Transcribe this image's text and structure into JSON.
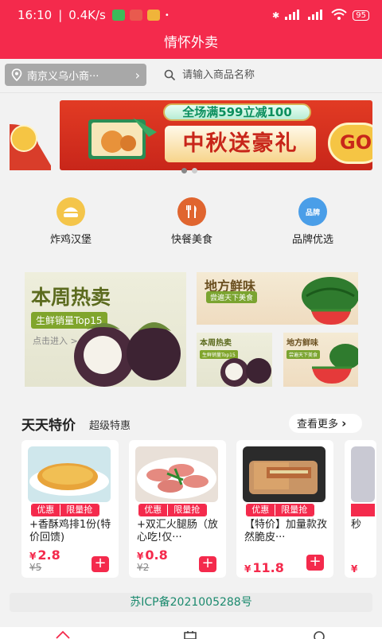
{
  "status_bar": {
    "time": "16:10",
    "speed": "0.4K/s",
    "battery": "95",
    "signal_label": "HD"
  },
  "header": {
    "title": "情怀外卖"
  },
  "location": {
    "label": "南京义乌小商···"
  },
  "search": {
    "placeholder": "请输入商品名称"
  },
  "banner": {
    "top_text": "全场满599立减100",
    "title": "中秋送豪礼",
    "go_label": "GO"
  },
  "categories": [
    {
      "label": "炸鸡汉堡",
      "icon": "burger-icon",
      "color": "#f4c54a"
    },
    {
      "label": "快餐美食",
      "icon": "fork-knife-icon",
      "color": "#e0652f"
    },
    {
      "label": "品牌优选",
      "icon": "brand-icon",
      "color": "#4a9ee8",
      "icon_text": "品牌"
    }
  ],
  "promos": {
    "big": {
      "title": "本周热卖",
      "tag": "生鲜销量Top15",
      "link": "点击进入 >"
    },
    "right_top": {
      "title": "地方鲜味",
      "tag": "尝遍天下美食"
    },
    "small_1": {
      "title": "本周热卖",
      "tag": "生鲜销量Top15"
    },
    "small_2": {
      "title": "地方鲜味",
      "tag": "尝遍天下美食"
    }
  },
  "deals": {
    "title": "天天特价",
    "subtitle": "超级特惠",
    "more_label": "查看更多",
    "tag_a": "优惠",
    "tag_b": "限量抢",
    "currency": "¥",
    "items": [
      {
        "name": "+香酥鸡排1份(特价回馈)",
        "price": "2.8",
        "orig": "¥5"
      },
      {
        "name": "+双汇火腿肠（放心吃!仅···",
        "price": "0.8",
        "orig": "¥2"
      },
      {
        "name": "【特价】加量款孜然脆皮···",
        "price": "11.8",
        "orig": ""
      },
      {
        "name": "秒",
        "price": "",
        "orig": ""
      }
    ]
  },
  "footer": {
    "icp": "苏ICP备2021005288号"
  },
  "colors": {
    "brand": "#f42a4c",
    "icp_text": "#1b8a6e"
  }
}
